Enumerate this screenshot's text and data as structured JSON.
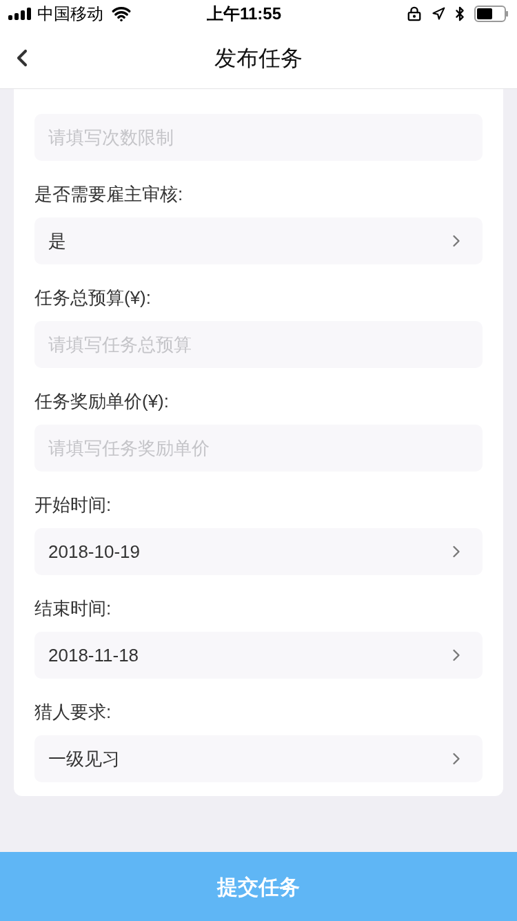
{
  "status_bar": {
    "carrier": "中国移动",
    "time": "上午11:55"
  },
  "nav": {
    "title": "发布任务"
  },
  "fields": [
    {
      "kind": "input",
      "placeholder": "请填写次数限制"
    },
    {
      "label": "是否需要雇主审核:",
      "kind": "select",
      "value": "是"
    },
    {
      "label": "任务总预算(¥):",
      "kind": "input",
      "placeholder": "请填写任务总预算"
    },
    {
      "label": "任务奖励单价(¥):",
      "kind": "input",
      "placeholder": "请填写任务奖励单价"
    },
    {
      "label": "开始时间:",
      "kind": "select",
      "value": "2018-10-19"
    },
    {
      "label": "结束时间:",
      "kind": "select",
      "value": "2018-11-18"
    },
    {
      "label": "猎人要求:",
      "kind": "select",
      "value": "一级见习"
    }
  ],
  "submit": "提交任务"
}
